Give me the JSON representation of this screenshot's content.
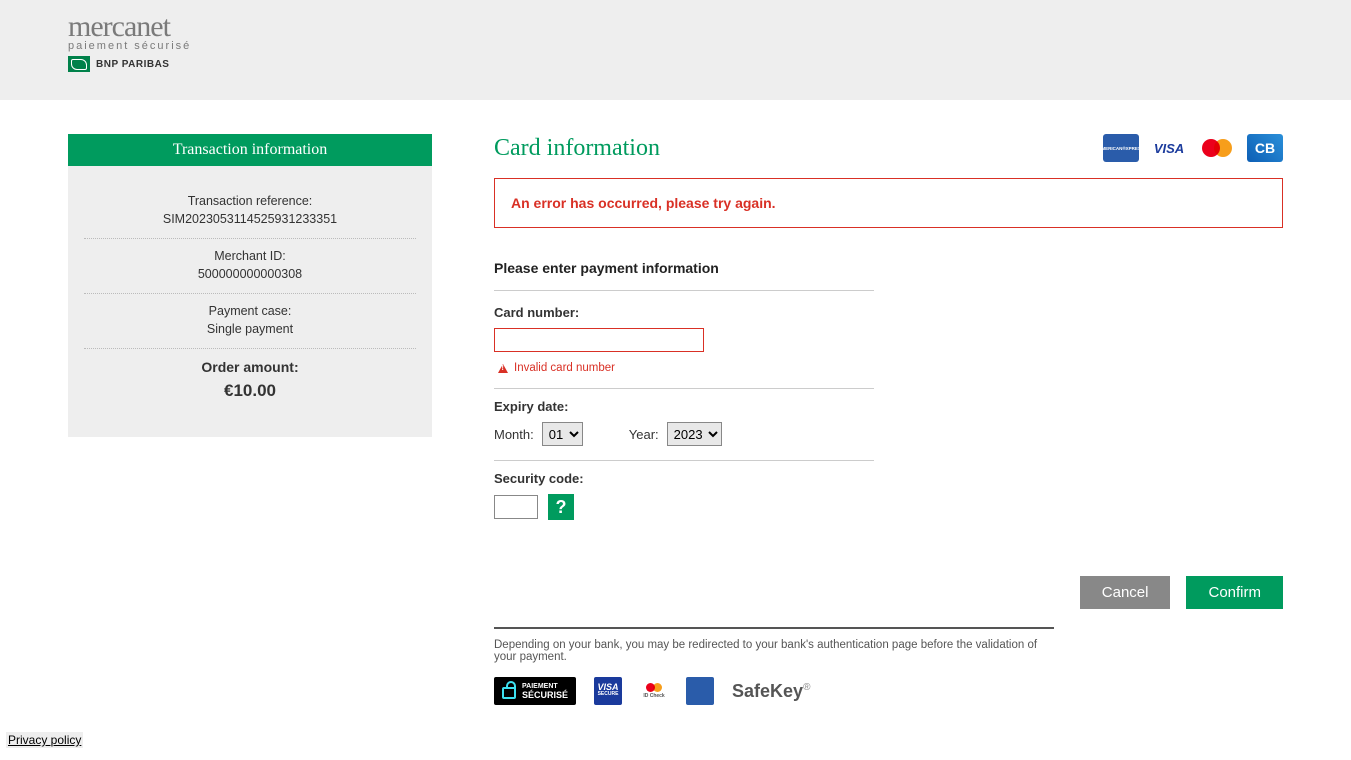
{
  "header": {
    "brand_main": "mercanet",
    "brand_sub": "paiement sécurisé",
    "bank": "BNP PARIBAS"
  },
  "sidebar": {
    "title": "Transaction information",
    "rows": [
      {
        "label": "Transaction reference:",
        "value": "SIM2023053114525931233351"
      },
      {
        "label": "Merchant ID:",
        "value": "500000000000308"
      },
      {
        "label": "Payment case:",
        "value": "Single payment"
      }
    ],
    "order_label": "Order amount:",
    "order_value": "€10.00"
  },
  "main": {
    "title": "Card information",
    "error": "An error has occurred, please try again.",
    "form_heading": "Please enter payment information",
    "card_number_label": "Card number:",
    "card_number_error": "Invalid card number",
    "expiry_label": "Expiry date:",
    "month_label": "Month:",
    "month_value": "01",
    "year_label": "Year:",
    "year_value": "2023",
    "cvv_label": "Security code:",
    "help_label": "?",
    "cancel": "Cancel",
    "confirm": "Confirm",
    "footer_note": "Depending on your bank, you may be redirected to your bank's authentication page before the validation of your payment.",
    "sec_paiement_line1": "PAIEMENT",
    "sec_paiement_line2": "SÉCURISÉ",
    "safekey": "SafeKey"
  },
  "footer": {
    "privacy": "Privacy policy"
  },
  "cards": {
    "visa": "VISA",
    "visa_secure": "VISA",
    "visa_secure2": "SECURE",
    "mc_id": "ID Check"
  }
}
